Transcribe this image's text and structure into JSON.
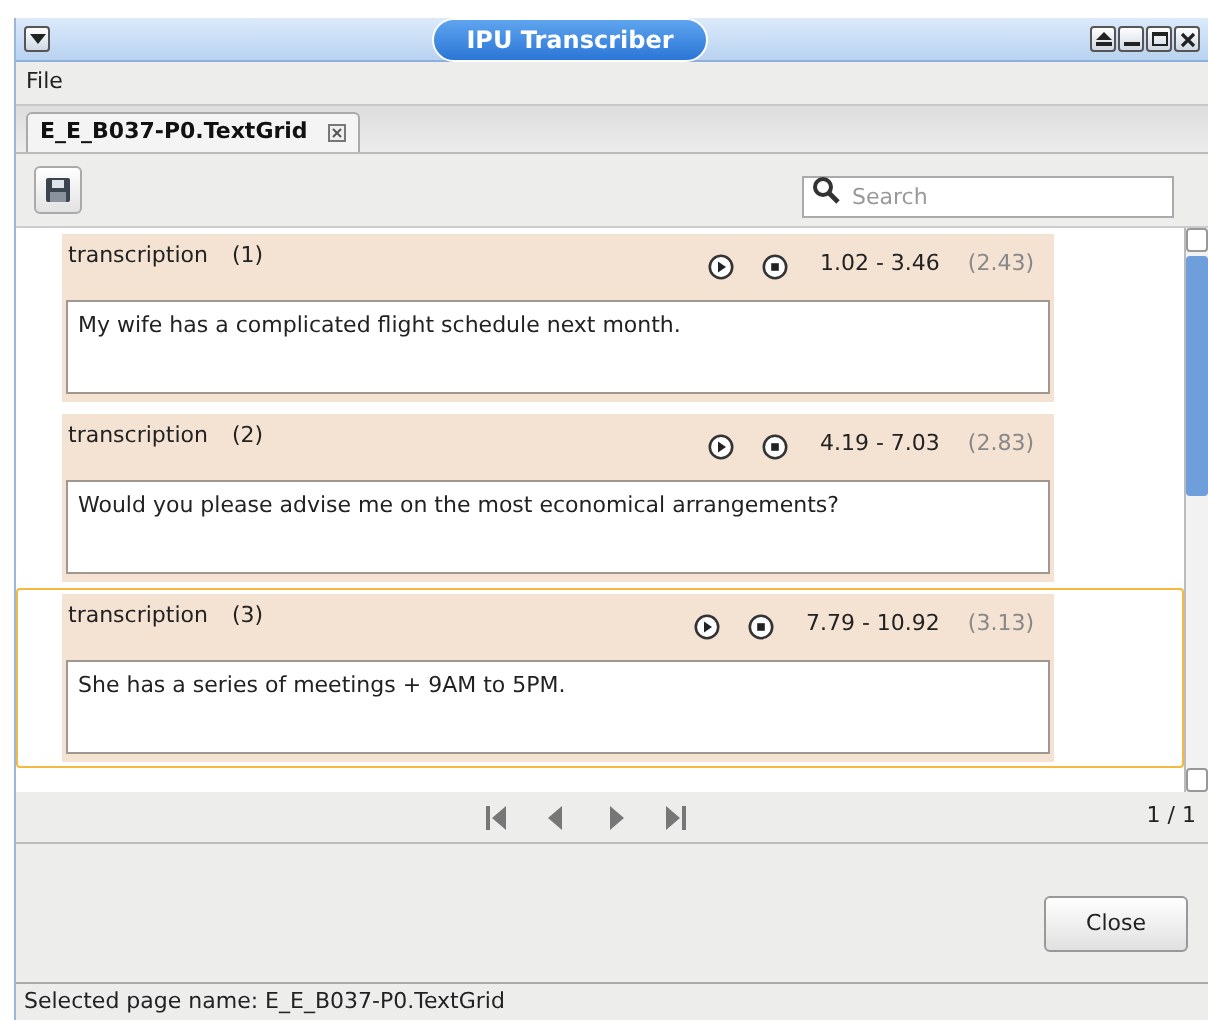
{
  "window": {
    "title": "IPU Transcriber"
  },
  "menu": [
    "File"
  ],
  "tabs": [
    {
      "label": "E_E_B037-P0.TextGrid",
      "selected": true
    }
  ],
  "search": {
    "placeholder": "Search"
  },
  "entries": [
    {
      "label": "transcription",
      "index": "(1)",
      "range": "1.02 - 3.46",
      "duration": "(2.43)",
      "text": "My wife has a complicated flight schedule next month.",
      "selected": false
    },
    {
      "label": "transcription",
      "index": "(2)",
      "range": "4.19 - 7.03",
      "duration": "(2.83)",
      "text": "Would you please advise me on the most economical arrangements?",
      "selected": false
    },
    {
      "label": "transcription",
      "index": "(3)",
      "range": "7.79 - 10.92",
      "duration": "(3.13)",
      "text": "She has a series of meetings + 9AM to 5PM.",
      "selected": true
    }
  ],
  "pager": "1 / 1",
  "buttons": [
    "Close"
  ],
  "status_bar": "Selected page name: E_E_B037-P0.TextGrid"
}
